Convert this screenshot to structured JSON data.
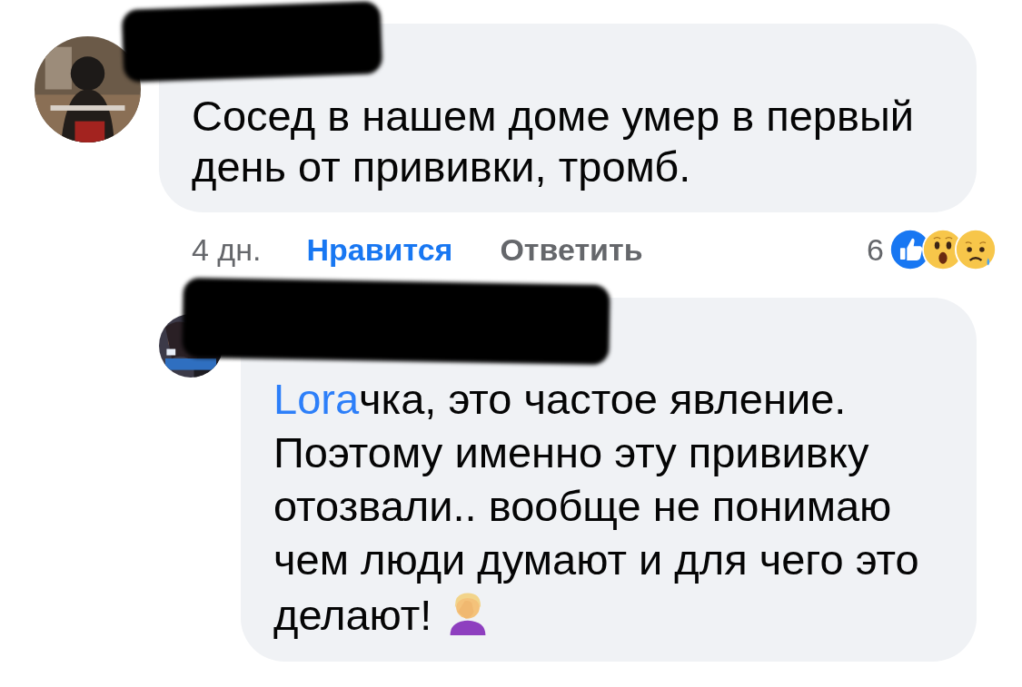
{
  "comments": [
    {
      "avatar": {
        "kind": "picture"
      },
      "redacted_name": true,
      "reply": false,
      "body": [
        {
          "kind": "text",
          "text": "Сосед в нашем доме умер в первый день от прививки, тромб."
        }
      ],
      "actions": {
        "time": "4 дн.",
        "like": "Нравится",
        "reply": "Ответить",
        "reaction_count": "6",
        "reactions": [
          {
            "kind": "like"
          },
          {
            "kind": "wow"
          },
          {
            "kind": "sad"
          }
        ]
      }
    },
    {
      "avatar": {
        "kind": "picture"
      },
      "redacted_name": true,
      "reply": true,
      "body": [
        {
          "kind": "mention",
          "text": "Lora"
        },
        {
          "kind": "text",
          "text": "чка, это частое явление. Поэтому именно эту прививку отозвали.. вообще не понимаю чем люди думают и для чего это делают!"
        },
        {
          "kind": "emoji"
        }
      ]
    }
  ]
}
